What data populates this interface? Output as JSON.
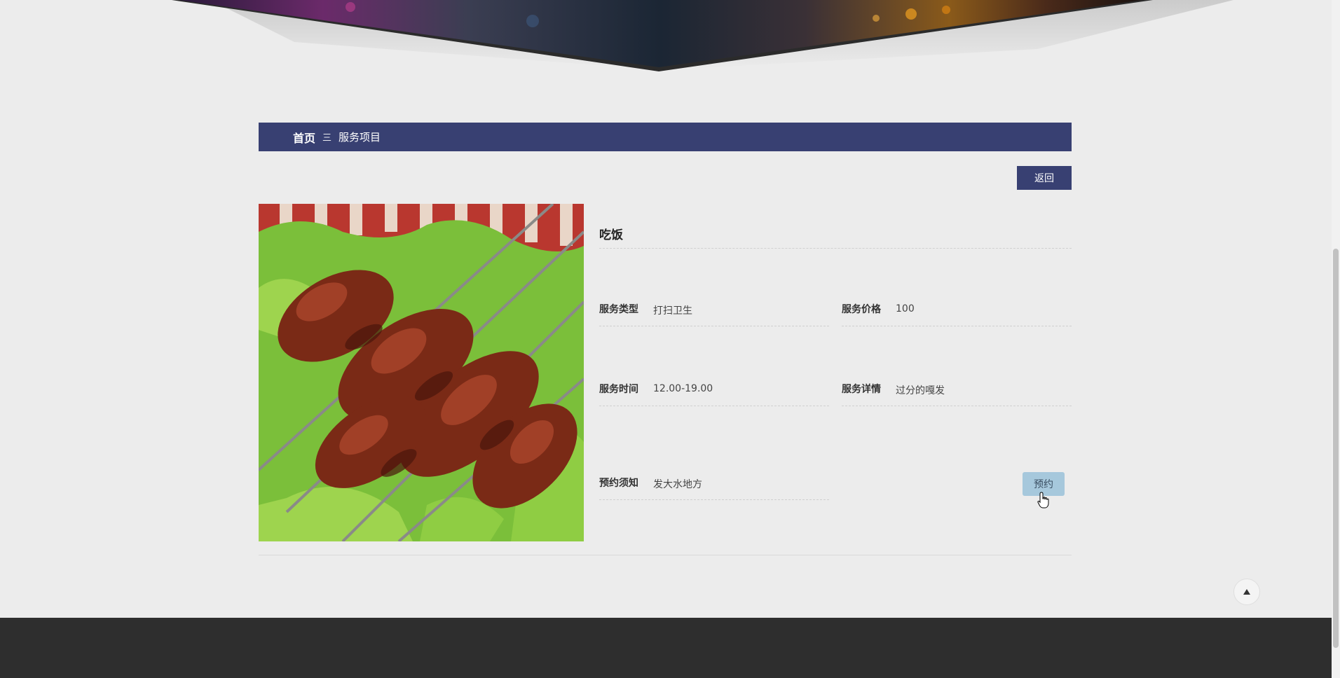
{
  "breadcrumb": {
    "home": "首页",
    "separator": "三",
    "current": "服务项目"
  },
  "back_label": "返回",
  "service": {
    "title": "吃饭",
    "type_label": "服务类型",
    "type_value": "打扫卫生",
    "price_label": "服务价格",
    "price_value": "100",
    "time_label": "服务时间",
    "time_value": "12.00-19.00",
    "detail_label": "服务详情",
    "detail_value": "过分的嘎发",
    "notice_label": "预约须知",
    "notice_value": "发大水地方"
  },
  "book_label": "预约",
  "colors": {
    "accent": "#384072",
    "book_button": "#a6c8dc",
    "footer": "#2e2e2e",
    "background": "#ececec"
  }
}
